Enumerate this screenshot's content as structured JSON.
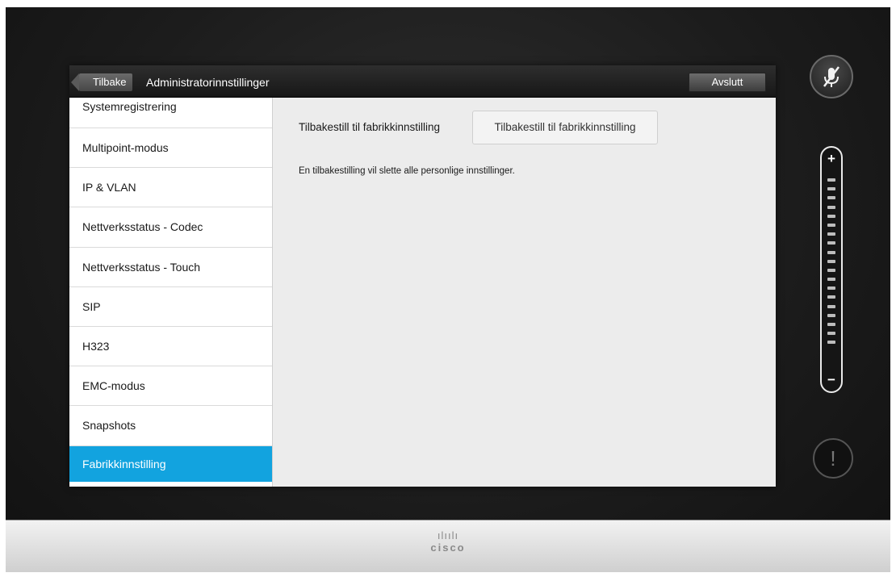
{
  "header": {
    "back_label": "Tilbake",
    "title": "Administratorinnstillinger",
    "exit_label": "Avslutt"
  },
  "sidebar": {
    "items": [
      {
        "label": "Systemregistrering"
      },
      {
        "label": "Multipoint-modus"
      },
      {
        "label": "IP & VLAN"
      },
      {
        "label": "Nettverksstatus - Codec"
      },
      {
        "label": "Nettverksstatus - Touch"
      },
      {
        "label": "SIP"
      },
      {
        "label": "H323"
      },
      {
        "label": "EMC-modus"
      },
      {
        "label": "Snapshots"
      },
      {
        "label": "Fabrikkinnstilling"
      }
    ],
    "active_index": 9
  },
  "main": {
    "setting_label": "Tilbakestill til fabrikkinnstilling",
    "reset_button_label": "Tilbakestill til fabrikkinnstilling",
    "info_text": "En tilbakestilling vil slette alle personlige innstillinger."
  },
  "side_controls": {
    "mute_icon": "microphone-muted-icon",
    "volume_plus": "+",
    "volume_minus": "−",
    "alert_symbol": "!"
  },
  "footer": {
    "brand": "cisco",
    "brand_bars": "ılıılı"
  },
  "colors": {
    "accent": "#12a3df",
    "titlebar": "#1f1f1f",
    "panel": "#ececec"
  }
}
